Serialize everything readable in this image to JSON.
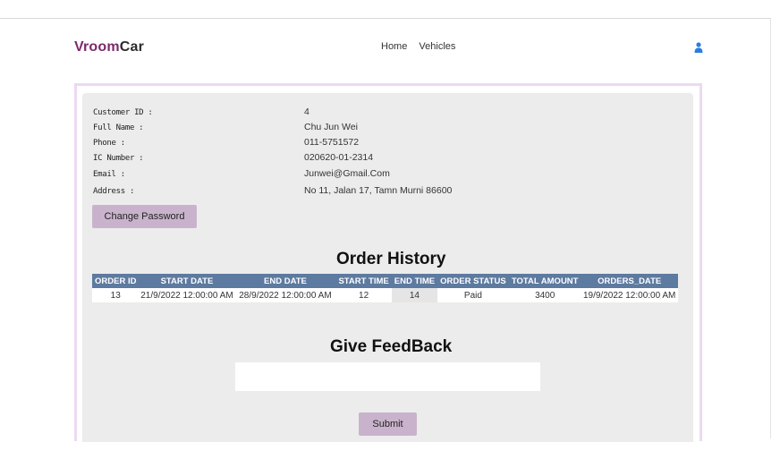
{
  "navbar": {
    "brand_part1": "Vroom",
    "brand_part2": "Car",
    "links": [
      "Home",
      "Vehicles"
    ],
    "user_icon": "user-icon",
    "brand_color": "#7b2a6b",
    "icon_color": "#2a7de1"
  },
  "profile": {
    "labels": [
      "Customer ID :",
      "Full Name :",
      "Phone :",
      "IC Number :",
      "Email :",
      "Address :"
    ],
    "values": [
      "4",
      "Chu Jun Wei",
      "011-5751572",
      "020620-01-2314",
      "Junwei@Gmail.Com",
      "No 11, Jalan 17, Tamn Murni 86600"
    ]
  },
  "change_password_label": "Change Password",
  "order_history": {
    "title": "Order History",
    "columns": [
      "ORDER ID",
      "START DATE",
      "END DATE",
      "START TIME",
      "END TIME",
      "ORDER STATUS",
      "TOTAL AMOUNT",
      "ORDERS_DATE"
    ],
    "rows": [
      [
        "13",
        "21/9/2022 12:00:00 AM",
        "28/9/2022 12:00:00 AM",
        "12",
        "14",
        "Paid",
        "3400",
        "19/9/2022 12:00:00 AM"
      ]
    ],
    "header_color": "#5d7aa0"
  },
  "feedback": {
    "title": "Give FeedBack",
    "input_value": "",
    "submit_label": "Submit"
  },
  "button_color": "#c9b3cc"
}
